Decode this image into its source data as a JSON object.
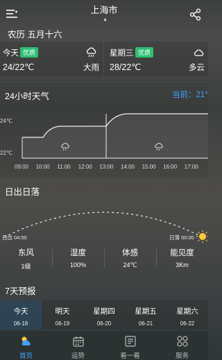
{
  "header": {
    "city": "上海市",
    "location_indicator": "▲"
  },
  "lunar_date": "农历 五月十六",
  "today_card": {
    "day": "今天",
    "aqi": "优质",
    "temp": "24/22℃",
    "condition": "大雨",
    "icon": "rain-cloud-icon"
  },
  "next_card": {
    "day": "星期三",
    "aqi": "优质",
    "temp": "28/22℃",
    "condition": "多云",
    "icon": "cloud-icon"
  },
  "hourly": {
    "title": "24小时天气",
    "current_label": "当前：21°",
    "temp_high": "24℃",
    "temp_low": "22℃",
    "times": [
      "09:00",
      "10:00",
      "11:00",
      "12:00",
      "13:00",
      "14:00",
      "15:00",
      "16:00",
      "17:00"
    ],
    "accent": "#3da1ff"
  },
  "sun": {
    "title": "日出日落",
    "sunrise": "日出 04:50",
    "sunset": "日落 00:00"
  },
  "stats": [
    {
      "label": "东风",
      "value": "1级"
    },
    {
      "label": "湿度",
      "value": "100%"
    },
    {
      "label": "体感",
      "value": "24℃"
    },
    {
      "label": "能见度",
      "value": "3Km"
    }
  ],
  "week": {
    "title": "7天预报",
    "days": [
      {
        "name": "今天",
        "date": "06-18"
      },
      {
        "name": "明天",
        "date": "06-19"
      },
      {
        "name": "星期四",
        "date": "06-20"
      },
      {
        "name": "星期五",
        "date": "06-21"
      },
      {
        "name": "星期六",
        "date": "06-22"
      }
    ]
  },
  "nav": [
    {
      "label": "首页",
      "icon": "home-cloud-icon"
    },
    {
      "label": "运势",
      "icon": "calendar-icon"
    },
    {
      "label": "看一看",
      "icon": "news-icon"
    },
    {
      "label": "服务",
      "icon": "grid-icon"
    }
  ],
  "colors": {
    "aqi_badge": "#2fbf71",
    "nav_active": "#3da1ff",
    "sun": "#ffc83a"
  }
}
